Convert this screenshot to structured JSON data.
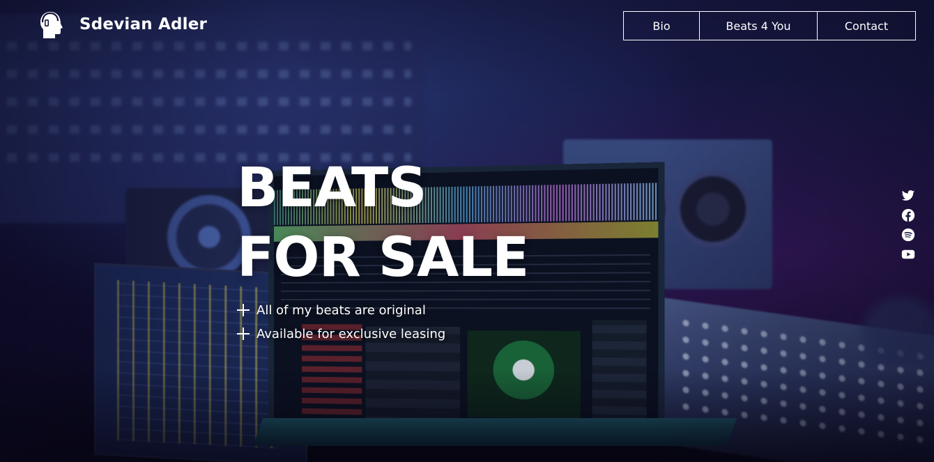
{
  "header": {
    "brand_name": "Sdevian Adler",
    "logo_icon": "headphones-head-icon"
  },
  "nav": {
    "items": [
      {
        "label": "Bio"
      },
      {
        "label": "Beats 4 You"
      },
      {
        "label": "Contact"
      }
    ]
  },
  "hero": {
    "title_line1": "BEATS",
    "title_line2": "FOR SALE",
    "features": [
      {
        "icon": "plus-icon",
        "text": "All of my beats are original"
      },
      {
        "icon": "plus-icon",
        "text": "Available for exclusive leasing"
      }
    ]
  },
  "social": {
    "icons": [
      "twitter-icon",
      "facebook-icon",
      "spotify-icon",
      "youtube-icon"
    ]
  },
  "colors": {
    "text": "#ffffff",
    "background_tint": "#15163f"
  }
}
